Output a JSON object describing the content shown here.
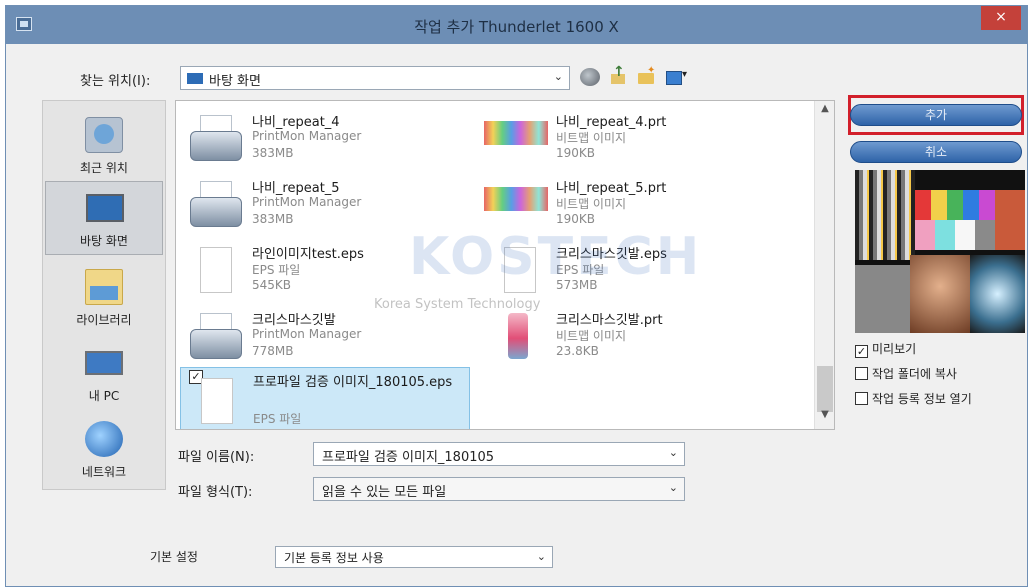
{
  "window": {
    "title": "작업 추가 Thunderlet 1600 X",
    "close_glyph": "×"
  },
  "toolbar": {
    "lookin_label": "찾는 위치(I):",
    "lookin_value": "바탕 화면",
    "icons": [
      "globe-icon",
      "up-folder-icon",
      "new-folder-icon",
      "view-menu-icon"
    ]
  },
  "places": [
    {
      "label": "최근 위치",
      "icon": "recent-places-icon"
    },
    {
      "label": "바탕 화면",
      "icon": "desktop-icon",
      "selected": true
    },
    {
      "label": "라이브러리",
      "icon": "library-icon"
    },
    {
      "label": "내 PC",
      "icon": "this-pc-icon"
    },
    {
      "label": "네트워크",
      "icon": "network-icon"
    }
  ],
  "files": [
    {
      "name": "나비_repeat_4",
      "type": "PrintMon Manager",
      "size": "383MB",
      "kind": "printer"
    },
    {
      "name": "나비_repeat_4.prt",
      "type": "비트맵 이미지",
      "size": "190KB",
      "kind": "bitmap"
    },
    {
      "name": "나비_repeat_5",
      "type": "PrintMon Manager",
      "size": "383MB",
      "kind": "printer"
    },
    {
      "name": "나비_repeat_5.prt",
      "type": "비트맵 이미지",
      "size": "190KB",
      "kind": "bitmap"
    },
    {
      "name": "라인이미지test.eps",
      "type": "EPS 파일",
      "size": "545KB",
      "kind": "doc"
    },
    {
      "name": "크리스마스깃발.eps",
      "type": "EPS 파일",
      "size": "573MB",
      "kind": "doc"
    },
    {
      "name": "크리스마스깃발",
      "type": "PrintMon Manager",
      "size": "778MB",
      "kind": "printer"
    },
    {
      "name": "크리스마스깃발.prt",
      "type": "비트맵 이미지",
      "size": "23.8KB",
      "kind": "bottle"
    },
    {
      "name": "프로파일 검증 이미지_180105.eps",
      "type": "EPS 파일",
      "size": "",
      "kind": "doc",
      "selected": true
    }
  ],
  "watermark": {
    "logo": "KOSTECH",
    "tagline": "Korea System Technology"
  },
  "fields": {
    "filename_label": "파일 이름(N):",
    "filename_value": "프로파일 검증 이미지_180105",
    "filetype_label": "파일 형식(T):",
    "filetype_value": "읽을 수 있는 모든 파일",
    "default_label": "기본 설정",
    "default_value": "기본 등록 정보 사용"
  },
  "buttons": {
    "add": "추가",
    "cancel": "취소"
  },
  "options": [
    {
      "label": "미리보기",
      "checked": true
    },
    {
      "label": "작업 폴더에 복사",
      "checked": false
    },
    {
      "label": "작업 등록 정보 열기",
      "checked": false
    }
  ],
  "colors": {
    "title_bar": "#6d8eb5",
    "button": "#2e63a8",
    "highlight": "#d21f2b",
    "selection": "#cce8f8"
  }
}
